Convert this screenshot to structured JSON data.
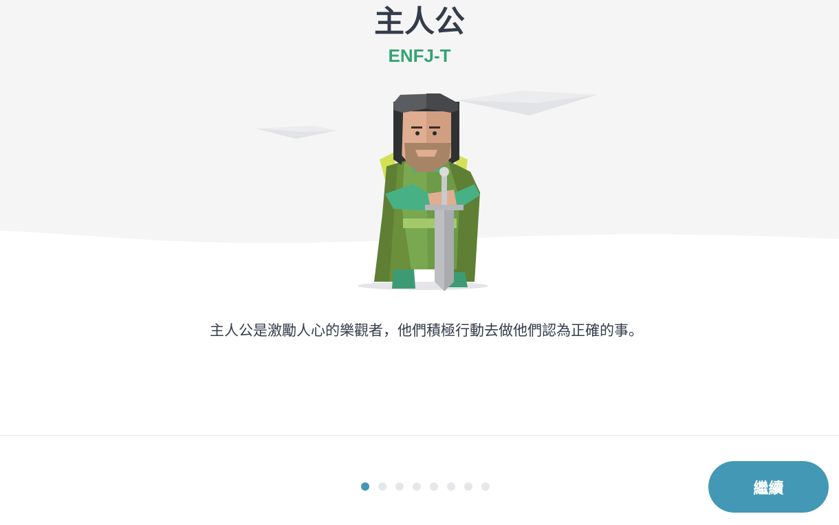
{
  "header": {
    "title": "主人公",
    "type_code": "ENFJ-T"
  },
  "description": "主人公是激勵人心的樂觀者，他們積極行動去做他們認為正確的事。",
  "progress": {
    "total_steps": 8,
    "current_step": 1
  },
  "footer": {
    "continue_label": "繼續"
  },
  "colors": {
    "title": "#343c4b",
    "type_code": "#33a474",
    "accent": "#4298b5",
    "inactive_dot": "#e6e7ea",
    "sky": "#f5f5f5"
  },
  "illustration": {
    "icon": "protagonist-knight-illustration"
  }
}
